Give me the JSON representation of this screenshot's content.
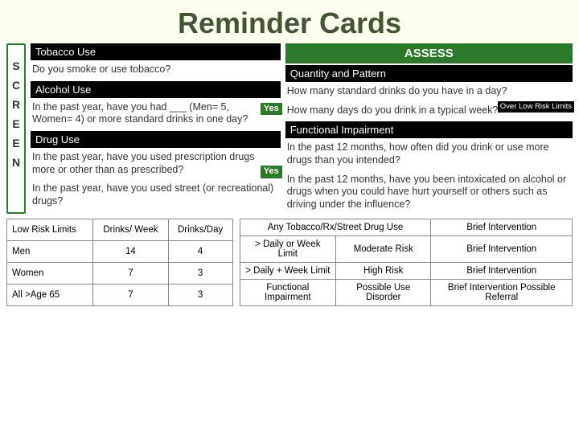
{
  "title": "Reminder Cards",
  "screen": [
    "S",
    "C",
    "R",
    "E",
    "E",
    "N"
  ],
  "left": {
    "tobacco_hdr": "Tobacco Use",
    "tobacco_q": "Do you smoke or use tobacco?",
    "alcohol_hdr": "Alcohol Use",
    "alcohol_q": "In the past year, have you had ___ (Men= 5, Women= 4) or more standard drinks in one day?",
    "yes1": "Yes",
    "drug_hdr": "Drug Use",
    "drug_q1": "In the past year, have you used prescription drugs more or other than as prescribed?",
    "yes2": "Yes",
    "drug_q2": "In the past year, have you used street (or recreational) drugs?"
  },
  "right": {
    "assess": "ASSESS",
    "qp_hdr": "Quantity and Pattern",
    "q1": "How many standard drinks do you have in a day?",
    "q2": "How many days do you drink in a typical week?",
    "overbox": "Over Low Risk Limits",
    "fi_hdr": "Functional Impairment",
    "fi_q1": "In the past 12 months, how often did you drink or use more drugs than you intended?",
    "fi_q2": "In the past 12 months, have you been intoxicated on alcohol or drugs when you could have hurt yourself or others such as driving under the influence?"
  },
  "table1": {
    "h1": "Low Risk Limits",
    "h2": "Drinks/ Week",
    "h3": "Drinks/Day",
    "rows": [
      {
        "c1": "Men",
        "c2": "14",
        "c3": "4"
      },
      {
        "c1": "Women",
        "c2": "7",
        "c3": "3"
      },
      {
        "c1": "All >Age 65",
        "c2": "7",
        "c3": "3"
      }
    ]
  },
  "table2": {
    "h1": "Any Tobacco/Rx/Street Drug Use",
    "h1b": "Brief Intervention",
    "rows": [
      {
        "c1": "> Daily or Week Limit",
        "c2": "Moderate Risk",
        "c3": "Brief Intervention"
      },
      {
        "c1": "> Daily + Week Limit",
        "c2": "High Risk",
        "c3": "Brief Intervention"
      },
      {
        "c1": "Functional Impairment",
        "c2": "Possible Use Disorder",
        "c3": "Brief Intervention Possible Referral"
      }
    ]
  }
}
